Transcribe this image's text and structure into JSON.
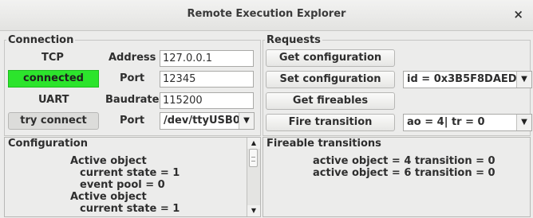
{
  "window": {
    "title": "Remote Execution Explorer",
    "close_glyph": "×"
  },
  "connection": {
    "legend": "Connection",
    "tcp_label": "TCP",
    "tcp_status": "connected",
    "address_label": "Address",
    "address_value": "127.0.0.1",
    "port_label": "Port",
    "port_value": "12345",
    "uart_label": "UART",
    "try_connect": "try connect",
    "baudrate_label": "Baudrate",
    "baudrate_value": "115200",
    "uart_port_label": "Port",
    "uart_port_value": "/dev/ttyUSB0"
  },
  "requests": {
    "legend": "Requests",
    "get_configuration": "Get configuration",
    "set_configuration": "Set configuration",
    "get_fireables": "Get fireables",
    "fire_transition": "Fire transition",
    "id_combo": "id = 0x3B5F8DAED...",
    "ao_combo": "ao = 4| tr = 0"
  },
  "configuration": {
    "title": "Configuration",
    "lines": [
      "Active object",
      "current state = 1",
      "event pool = 0",
      "Active object",
      "current state = 1"
    ]
  },
  "fireable": {
    "title": "Fireable transitions",
    "lines": [
      "active object = 4 transition = 0",
      "active object = 6 transition = 0"
    ]
  },
  "icons": {
    "arrow_down": "chevron-down-icon",
    "arrow_up": "chevron-up-icon"
  },
  "colors": {
    "connected": "#2ce42c"
  }
}
